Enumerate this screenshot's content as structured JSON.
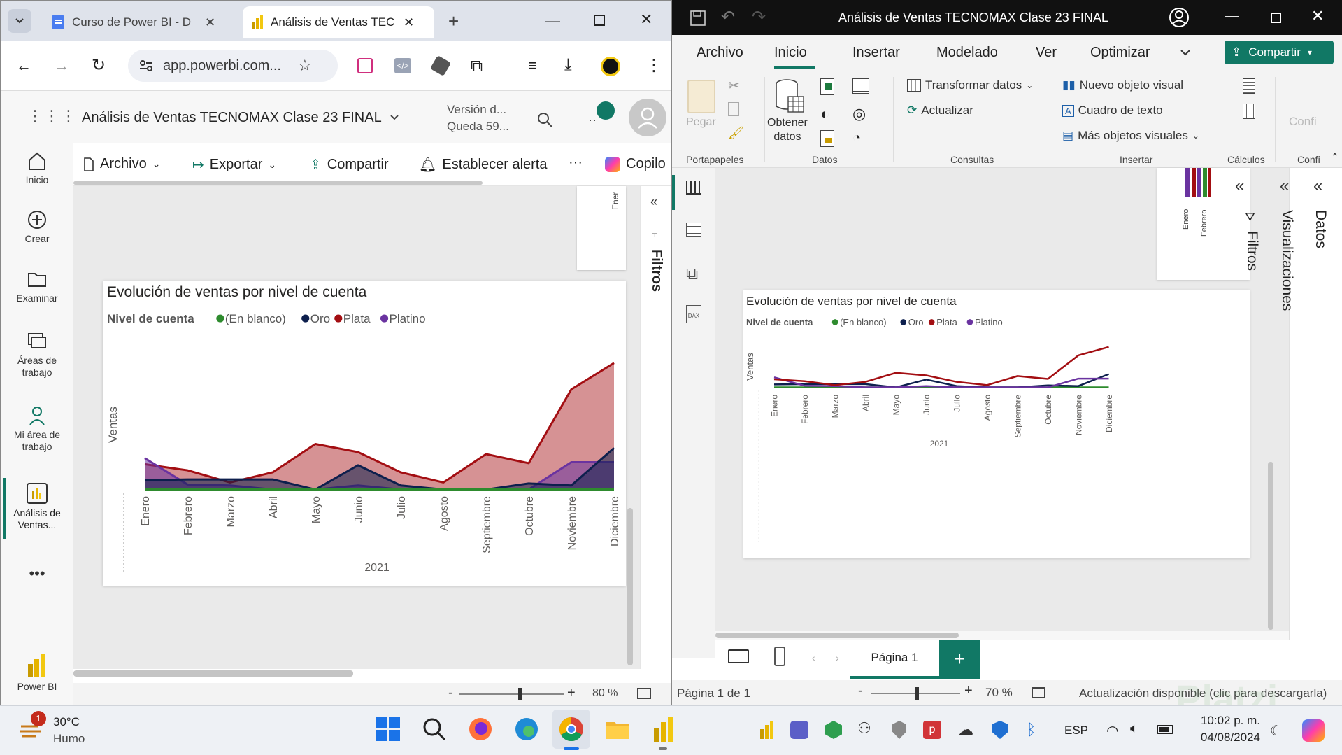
{
  "browser": {
    "tabs": [
      {
        "title": "Curso de Power BI - D"
      },
      {
        "title": "Análisis de Ventas TEC"
      }
    ],
    "url": "app.powerbi.com..."
  },
  "service": {
    "report_title": "Análisis de Ventas TECNOMAX Clase 23 FINAL",
    "version_line1": "Versión d...",
    "version_line2": "Queda 59...",
    "nav": [
      "Inicio",
      "Crear",
      "Examinar",
      "Áreas de trabajo",
      "Mi área de trabajo",
      "Análisis de Ventas...",
      "Power BI"
    ],
    "toolbar": [
      "Archivo",
      "Exportar",
      "Compartir",
      "Establecer alerta",
      "Copilo"
    ],
    "filters_label": "Filtros",
    "zoom": "80 %",
    "zoom_level": 0.56,
    "top_visual_axis_label": "Ener"
  },
  "desktop": {
    "window_title": "Análisis de Ventas TECNOMAX Clase 23 FINAL",
    "menu": [
      "Archivo",
      "Inicio",
      "Insertar",
      "Modelado",
      "Ver",
      "Optimizar"
    ],
    "share_label": "Compartir",
    "ribbon": {
      "paste": "Pegar",
      "get_data_l1": "Obtener",
      "get_data_l2": "datos",
      "transform": "Transformar datos",
      "refresh": "Actualizar",
      "new_visual": "Nuevo objeto visual",
      "text_box": "Cuadro de texto",
      "more_visuals": "Más objetos visuales",
      "config": "Confi",
      "groups": [
        "Portapapeles",
        "Datos",
        "Consultas",
        "Insertar",
        "Cálculos",
        "Confi"
      ]
    },
    "panes": [
      "Filtros",
      "Visualizaciones",
      "Datos"
    ],
    "page_tab": "Página 1",
    "status_page": "Página 1 de 1",
    "zoom": "70 %",
    "zoom_level": 0.5,
    "update_msg": "Actualización disponible (clic para descargarla)",
    "top_visual_axis": [
      "Enero",
      "Febrero"
    ],
    "watermark": "Platzi"
  },
  "taskbar": {
    "weather_temp": "30°C",
    "weather_desc": "Humo",
    "weather_badge": "1",
    "lang": "ESP",
    "time": "10:02 p. m.",
    "date": "04/08/2024"
  },
  "colors": {
    "en_blanco": "#2e8b2e",
    "oro": "#0d1f4d",
    "plata": "#a30e12",
    "platino": "#6a33a0",
    "pbi_green": "#117865",
    "ribbon_accent": "#117865"
  },
  "chart_data": [
    {
      "type": "area",
      "title": "Evolución de ventas por nivel de cuenta",
      "legend_title": "Nivel de cuenta",
      "legend_position": "top-left",
      "ylabel": "Ventas",
      "xlabel": "2021",
      "categories": [
        "Enero",
        "Febrero",
        "Marzo",
        "Abril",
        "Mayo",
        "Junio",
        "Julio",
        "Agosto",
        "Septiembre",
        "Octubre",
        "Noviembre",
        "Diciembre"
      ],
      "series": [
        {
          "name": "(En blanco)",
          "values": [
            1,
            1,
            1,
            1,
            1,
            1,
            1,
            1,
            1,
            1,
            1,
            1
          ]
        },
        {
          "name": "Oro",
          "values": [
            10,
            11,
            11,
            11,
            1,
            25,
            5,
            1,
            1,
            7,
            5,
            42
          ]
        },
        {
          "name": "Plata",
          "values": [
            26,
            20,
            8,
            18,
            46,
            38,
            18,
            8,
            36,
            27,
            100,
            126
          ]
        },
        {
          "name": "Platino",
          "values": [
            32,
            6,
            5,
            1,
            1,
            5,
            1,
            1,
            1,
            1,
            28,
            28
          ]
        }
      ],
      "grid": false
    },
    {
      "type": "line",
      "title": "Evolución de ventas por nivel de cuenta",
      "legend_title": "Nivel de cuenta",
      "legend_position": "top-left",
      "ylabel": "Ventas",
      "xlabel": "2021",
      "categories": [
        "Enero",
        "Febrero",
        "Marzo",
        "Abril",
        "Mayo",
        "Junio",
        "Julio",
        "Agosto",
        "Septiembre",
        "Octubre",
        "Noviembre",
        "Diciembre"
      ],
      "series": [
        {
          "name": "(En blanco)",
          "values": [
            1,
            1,
            1,
            1,
            1,
            1,
            1,
            1,
            1,
            1,
            1,
            1
          ]
        },
        {
          "name": "Oro",
          "values": [
            10,
            11,
            11,
            11,
            1,
            25,
            5,
            1,
            1,
            7,
            5,
            42
          ]
        },
        {
          "name": "Plata",
          "values": [
            26,
            20,
            8,
            18,
            46,
            38,
            18,
            8,
            36,
            27,
            100,
            126
          ]
        },
        {
          "name": "Platino",
          "values": [
            32,
            6,
            5,
            1,
            1,
            5,
            1,
            1,
            1,
            1,
            28,
            28
          ]
        }
      ],
      "grid": false
    }
  ]
}
